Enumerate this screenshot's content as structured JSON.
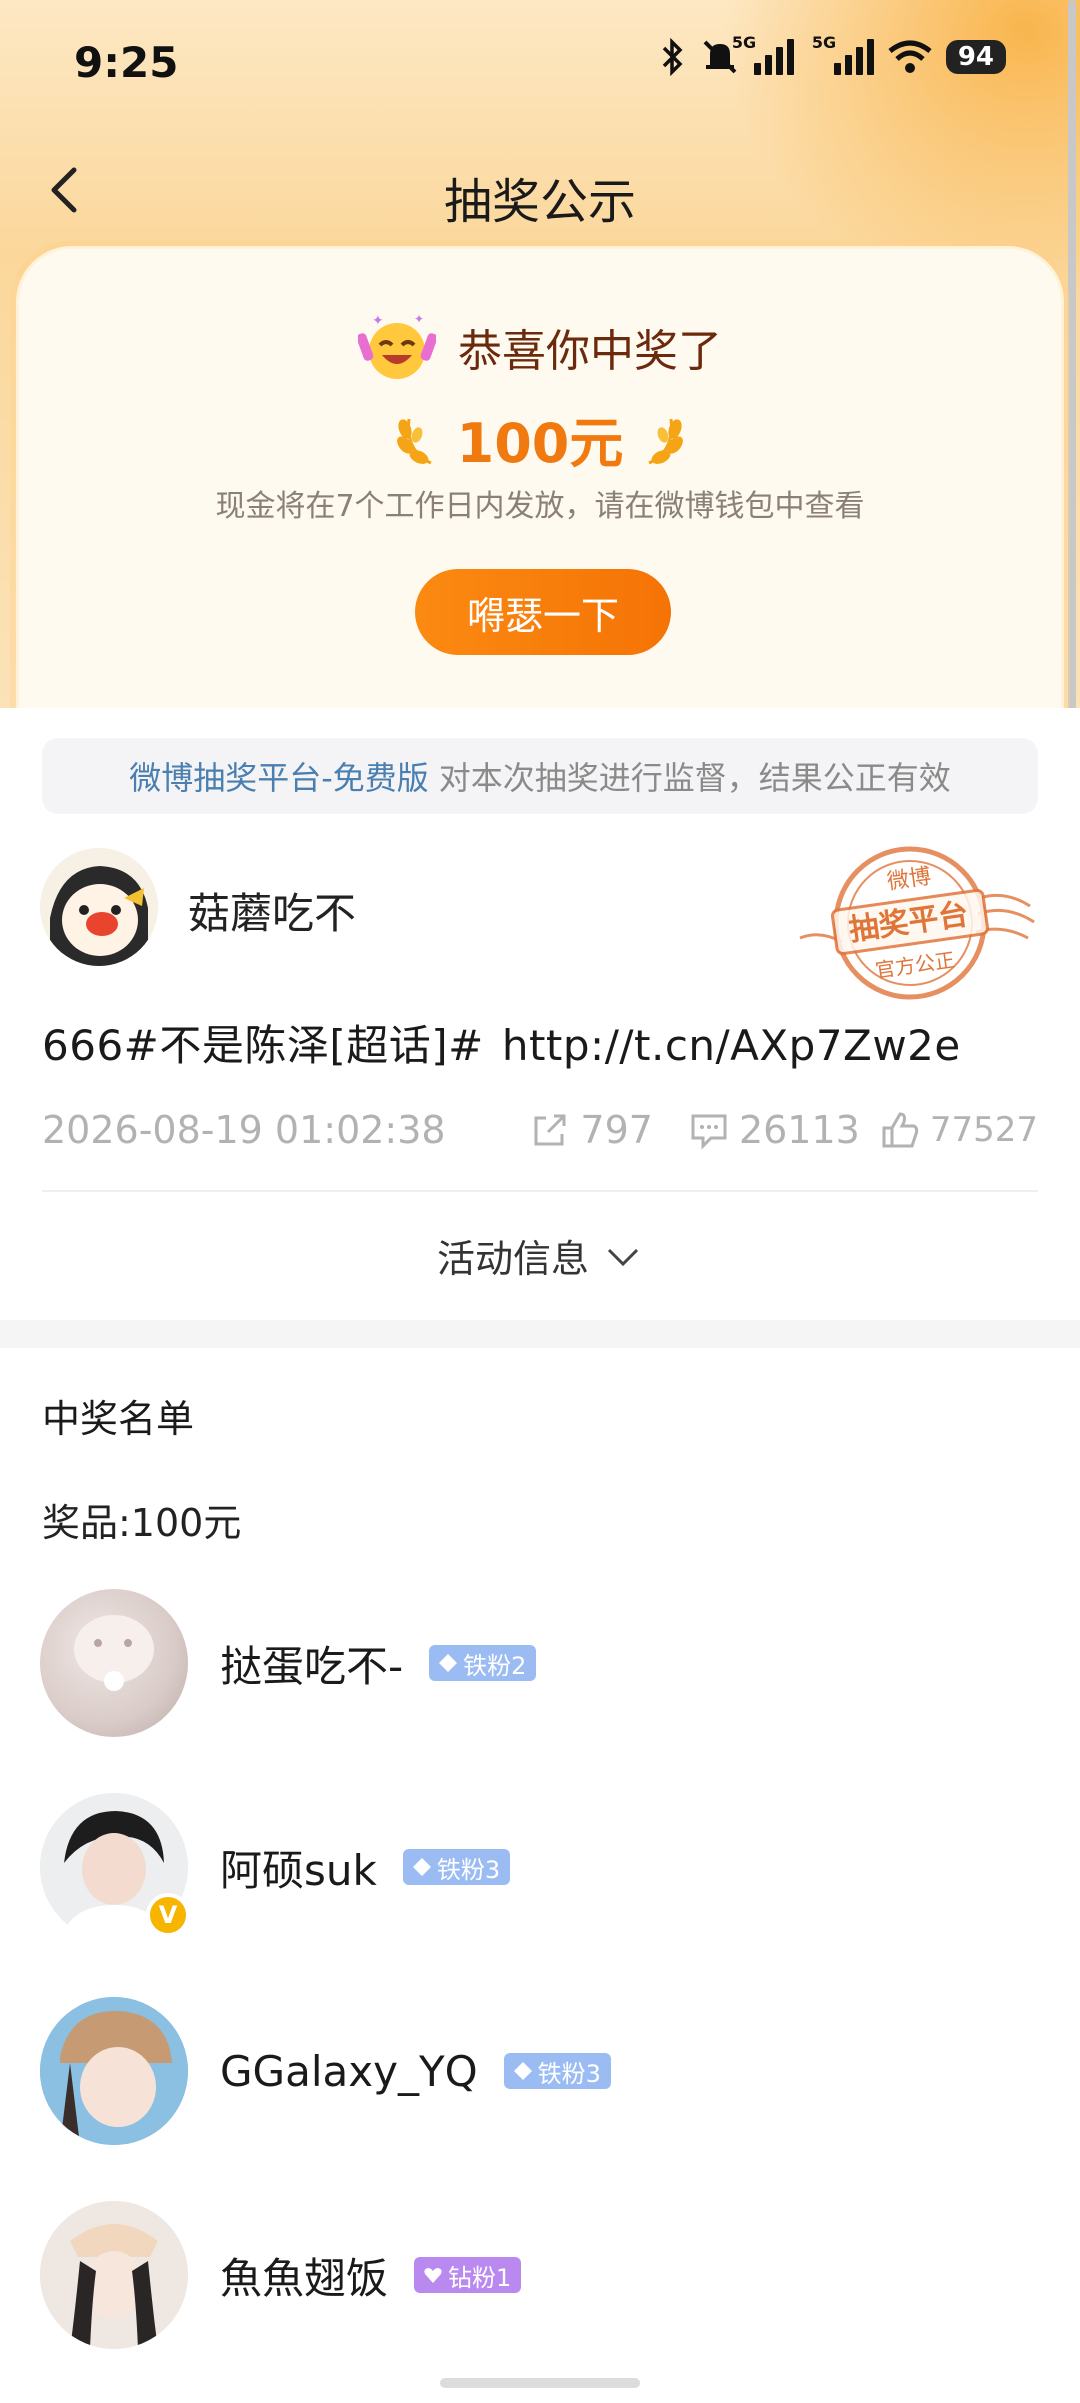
{
  "status_bar": {
    "time": "9:25",
    "battery": "94",
    "net1": "5G",
    "net2": "5G"
  },
  "nav": {
    "title": "抽奖公示"
  },
  "prize_card": {
    "congrats": "恭喜你中奖了",
    "amount": "100元",
    "description": "现金将在7个工作日内发放，请在微博钱包中查看",
    "share_button": "嘚瑟一下"
  },
  "monitor": {
    "link": "微博抽奖平台-免费版",
    "text": "对本次抽奖进行监督，结果公正有效"
  },
  "post": {
    "author": "菇蘑吃不",
    "text": "666#不是陈泽[超话]#",
    "link": "http://t.cn/AXp7Zw2e",
    "time": "2026-08-19 01:02:38",
    "reposts": "797",
    "comments": "26113",
    "likes": "77527"
  },
  "stamp": {
    "top": "微博",
    "middle": "抽奖平台",
    "bottom": "官方公正"
  },
  "activity_info": "活动信息",
  "winners": {
    "title": "中奖名单",
    "prize_label": "奖品:100元",
    "list": [
      {
        "name": "挞蛋吃不-",
        "badge": "铁粉2",
        "badge_type": "iron"
      },
      {
        "name": "阿硕suk",
        "badge": "铁粉3",
        "badge_type": "iron"
      },
      {
        "name": "GGalaxy_YQ",
        "badge": "铁粉3",
        "badge_type": "iron"
      },
      {
        "name": "魚魚翅饭",
        "badge": "钻粉1",
        "badge_type": "diamond"
      }
    ]
  },
  "colors": {
    "accent": "#f57305",
    "link": "#4a7fb0",
    "stamp": "#e0753a"
  }
}
